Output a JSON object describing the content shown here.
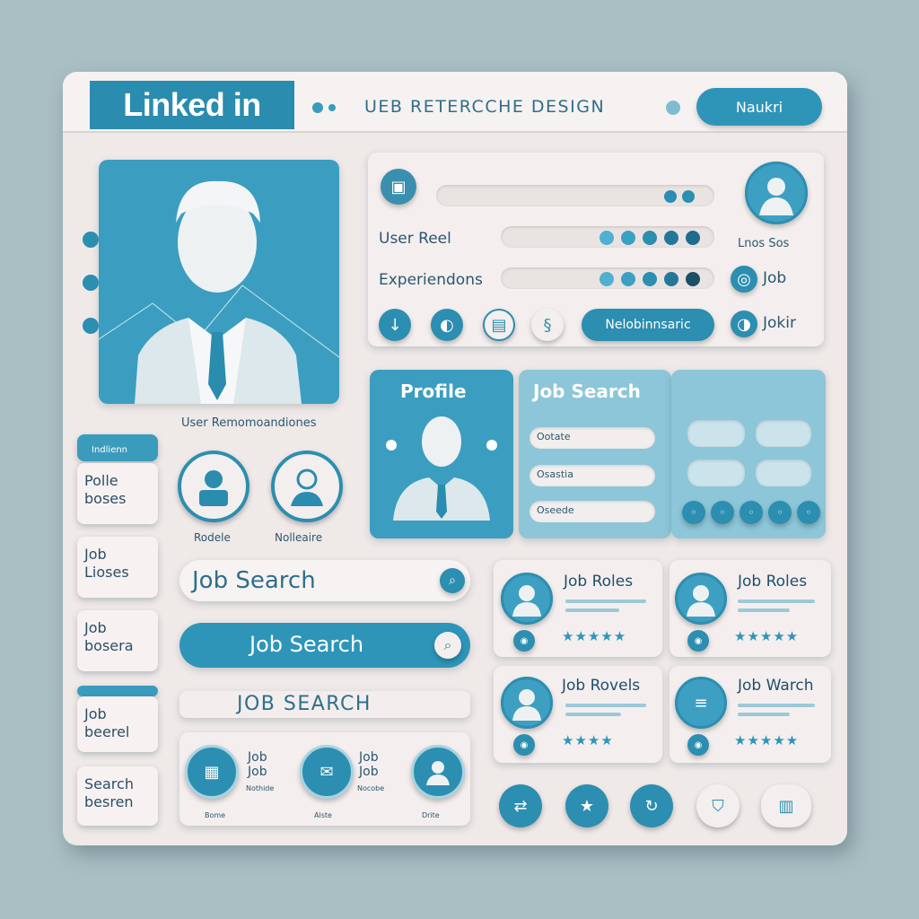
{
  "header": {
    "logo": "Linked in",
    "title": "UEB RETERCCHE DESIGN",
    "naukri_button": "Naukri"
  },
  "profile_panel": {
    "caption": "User Remomoandiones"
  },
  "info_card": {
    "row1_label": "User Reel",
    "row2_label": "Experiendons",
    "right_label_top": "Lnos Sos",
    "right_item_job": "Job",
    "right_item_jokir": "Jokir",
    "action_button": "Nelobinnsaric"
  },
  "profile_tab": {
    "label": "Profile"
  },
  "job_search_tab": {
    "title": "Job Search",
    "fields": [
      "Ootate",
      "Osastia",
      "Oseede"
    ]
  },
  "avatars": {
    "left_label": "Rodele",
    "right_label": "Nolleaire"
  },
  "side_tiles": {
    "top_tab": "Indlienn",
    "items": [
      "Polle\nboses",
      "Job\nLioses",
      "Job\nbosera",
      "Job\nbeerel",
      "Search\nbesren"
    ]
  },
  "search": {
    "input_placeholder": "Job Search",
    "button_label": "Job Search",
    "caps_label": "JOB SEARCH"
  },
  "bottom_card": {
    "items": [
      {
        "title": "Job\nJob",
        "sub": "Nothide",
        "foot": "Bome"
      },
      {
        "title": "Job\nJob",
        "sub": "Nocobe",
        "foot": "Alste"
      },
      {
        "title": "",
        "sub": "",
        "foot": "Drite"
      }
    ]
  },
  "job_cards": [
    {
      "title": "Job Roles",
      "rating": "★★★★★"
    },
    {
      "title": "Job Roles",
      "rating": "★★★★★"
    },
    {
      "title": "Job Rovels",
      "rating": "★★★★"
    },
    {
      "title": "Job Warch",
      "rating": "★★★★★"
    }
  ],
  "footer_buttons": [
    "share-icon",
    "star-icon",
    "refresh-icon",
    "shield-icon",
    "menu-icon"
  ],
  "colors": {
    "accent": "#2e95b9",
    "background": "#a9bfc4",
    "board": "#efe9e8"
  }
}
